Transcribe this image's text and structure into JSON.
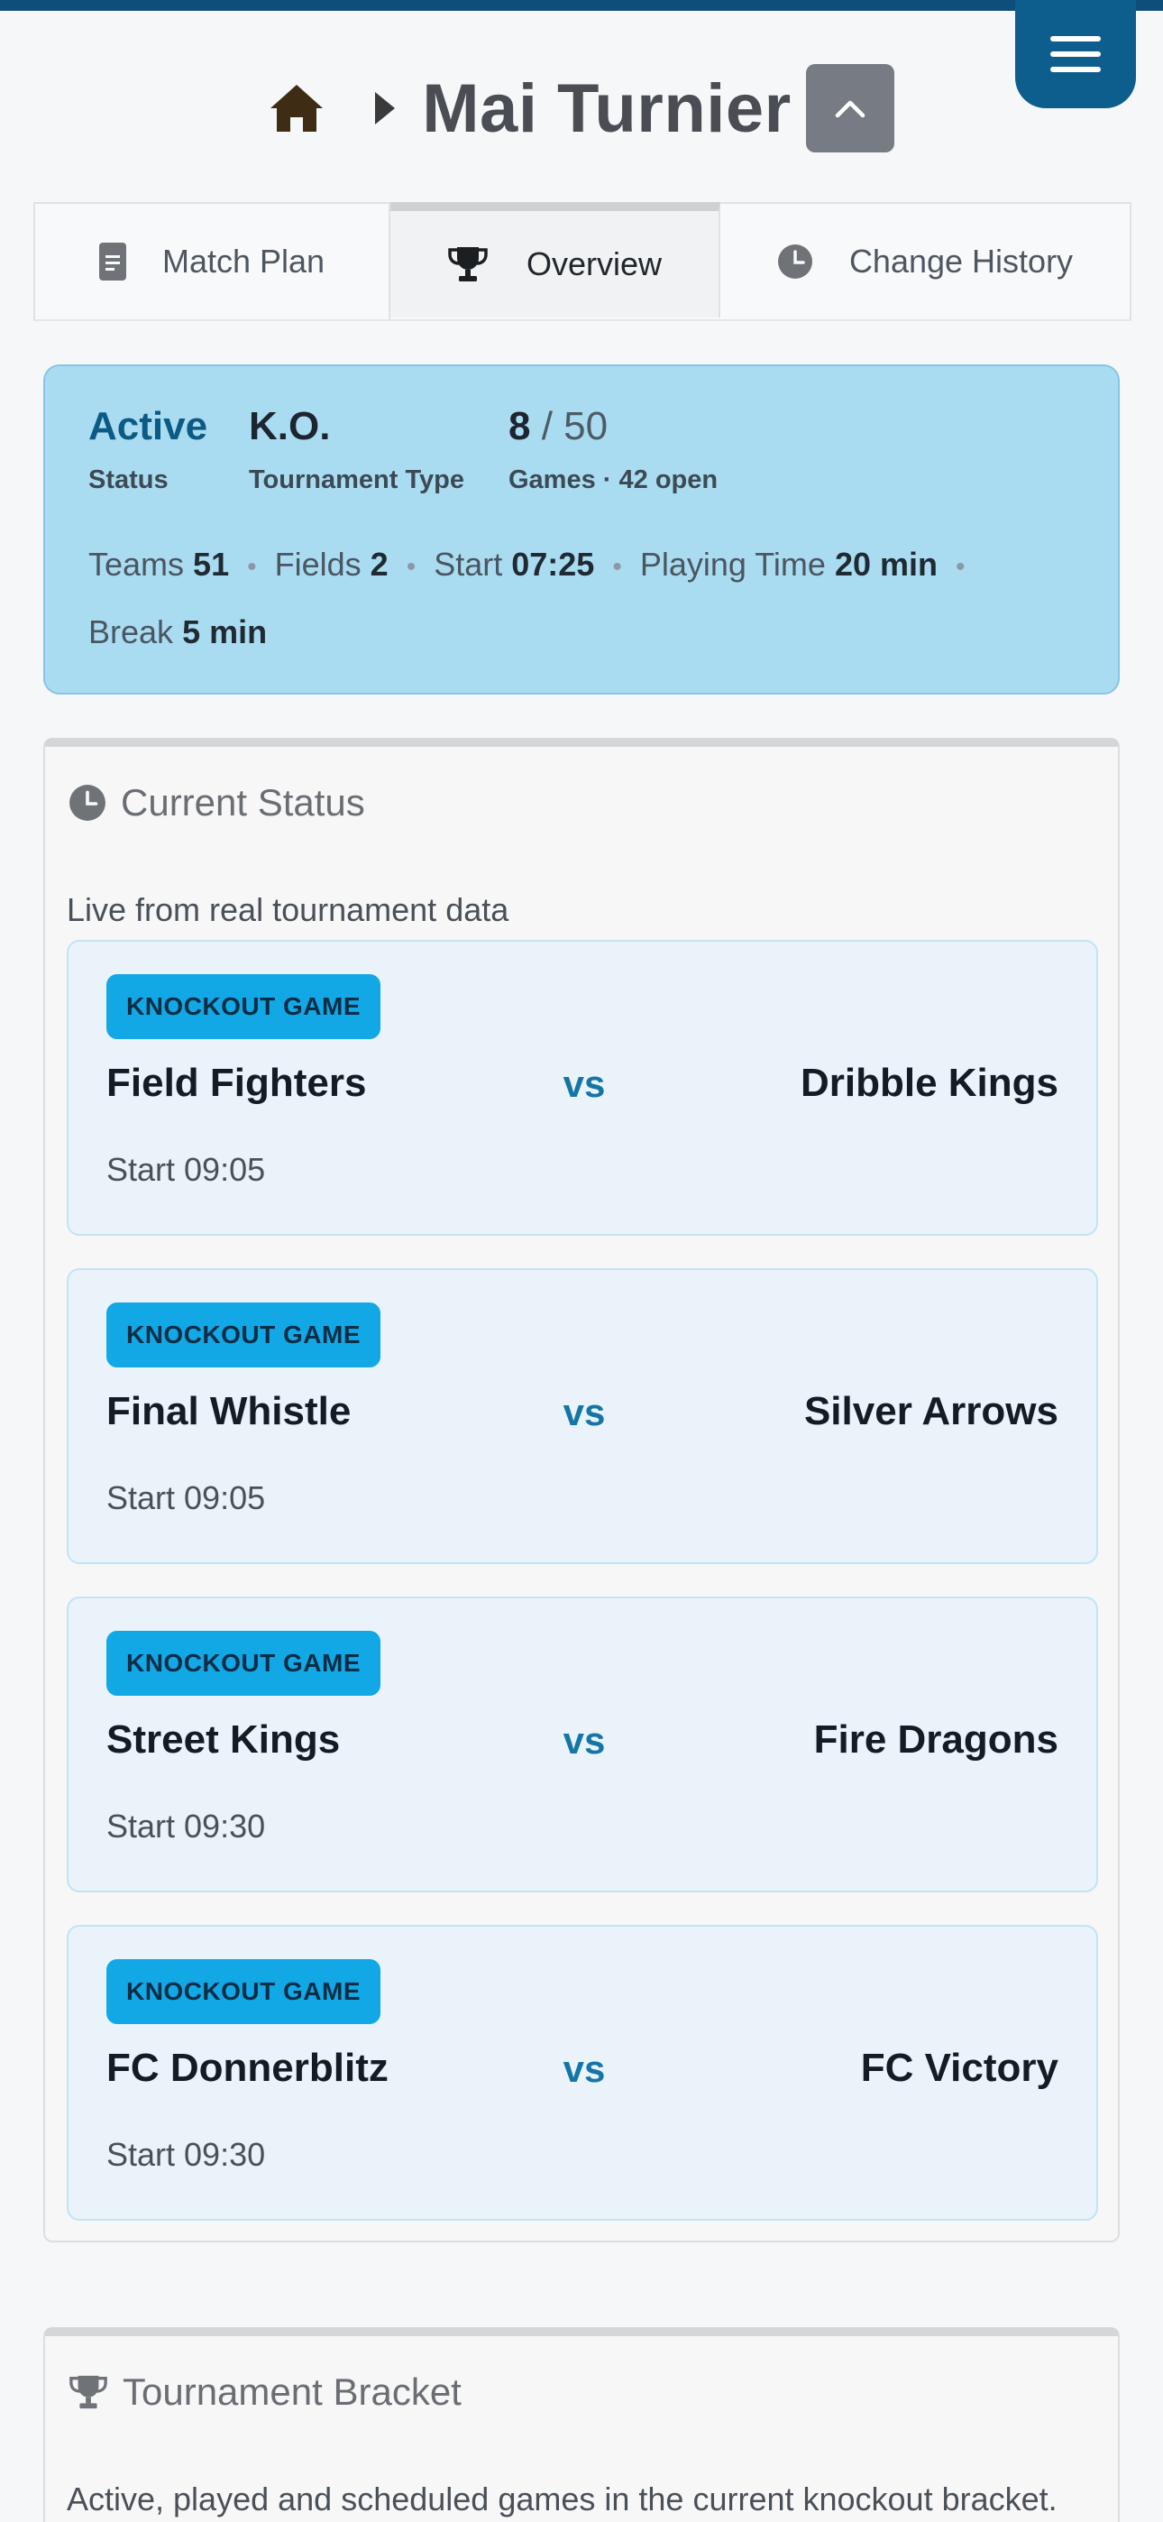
{
  "header": {
    "title": "Mai Turnier"
  },
  "tabs": [
    {
      "label": "Match Plan",
      "icon": "document-icon",
      "active": false
    },
    {
      "label": "Overview",
      "icon": "trophy-icon",
      "active": true
    },
    {
      "label": "Change History",
      "icon": "clock-icon",
      "active": false
    }
  ],
  "summary": {
    "status_value": "Active",
    "status_label": "Status",
    "type_value": "K.O.",
    "type_label": "Tournament Type",
    "games_played": "8",
    "games_slash": " / ",
    "games_total": "50",
    "games_label": "Games · 42 open",
    "stats": {
      "teams_label": "Teams",
      "teams_value": "51",
      "fields_label": "Fields",
      "fields_value": "2",
      "start_label": "Start",
      "start_value": "07:25",
      "playing_time_label": "Playing Time",
      "playing_time_value": "20 min",
      "break_label": "Break",
      "break_value": "5 min"
    }
  },
  "current_status": {
    "title": "Current Status",
    "subtitle": "Live from real tournament data",
    "games": [
      {
        "badge": "KNOCKOUT GAME",
        "home": "Field Fighters",
        "vs": "vs",
        "away": "Dribble Kings",
        "start": "Start 09:05"
      },
      {
        "badge": "KNOCKOUT GAME",
        "home": "Final Whistle",
        "vs": "vs",
        "away": "Silver Arrows",
        "start": "Start 09:05"
      },
      {
        "badge": "KNOCKOUT GAME",
        "home": "Street Kings",
        "vs": "vs",
        "away": "Fire Dragons",
        "start": "Start 09:30"
      },
      {
        "badge": "KNOCKOUT GAME",
        "home": "FC Donnerblitz",
        "vs": "vs",
        "away": "FC Victory",
        "start": "Start 09:30"
      }
    ]
  },
  "bracket": {
    "title": "Tournament Bracket",
    "subtitle": "Active, played and scheduled games in the current knockout bracket."
  },
  "colors": {
    "brand": "#0e5e8d",
    "summary_bg": "#aadcf1",
    "badge_bg": "#12a8e6",
    "vs": "#1576a6"
  }
}
